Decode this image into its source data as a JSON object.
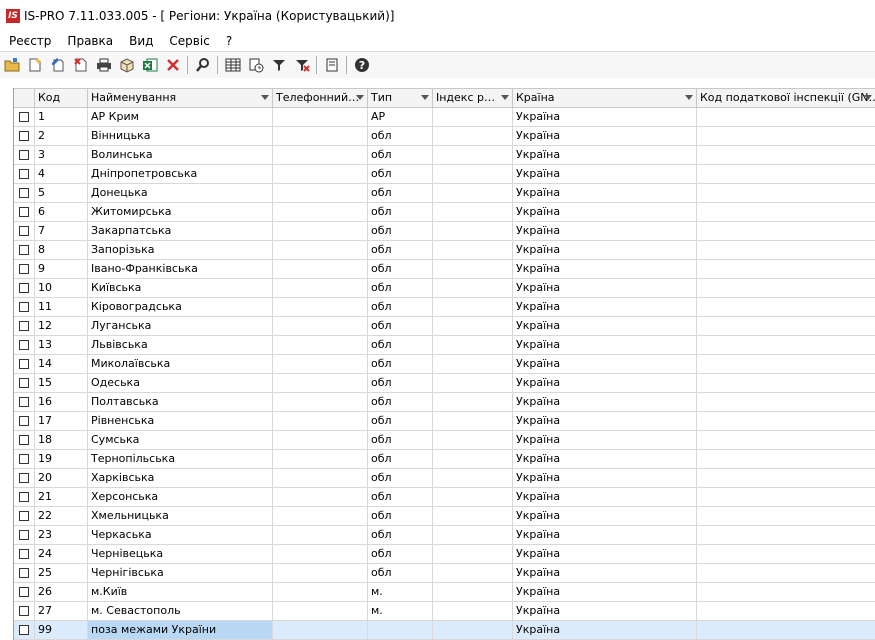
{
  "window": {
    "title": "IS-PRO 7.11.033.005 - [ Регіони: Україна (Користувацький)]",
    "logo_text": "IS"
  },
  "menu": [
    "Реєстр",
    "Правка",
    "Вид",
    "Сервіс",
    "?"
  ],
  "columns": {
    "code": "Код",
    "name": "Найменування",
    "phone": "Телефонний…",
    "type": "Тип",
    "index": "Індекс р…",
    "country": "Країна",
    "tax": "Код податкової інспекції (GN…"
  },
  "rows": [
    {
      "code": "1",
      "name": "АР Крим",
      "type": "АР",
      "country": "Україна"
    },
    {
      "code": "2",
      "name": "Вінницька",
      "type": "обл",
      "country": "Україна"
    },
    {
      "code": "3",
      "name": "Волинська",
      "type": "обл",
      "country": "Україна"
    },
    {
      "code": "4",
      "name": "Дніпропетровська",
      "type": "обл",
      "country": "Україна"
    },
    {
      "code": "5",
      "name": "Донецька",
      "type": "обл",
      "country": "Україна"
    },
    {
      "code": "6",
      "name": "Житомирська",
      "type": "обл",
      "country": "Україна"
    },
    {
      "code": "7",
      "name": "Закарпатська",
      "type": "обл",
      "country": "Україна"
    },
    {
      "code": "8",
      "name": "Запорізька",
      "type": "обл",
      "country": "Україна"
    },
    {
      "code": "9",
      "name": "Івано-Франківська",
      "type": "обл",
      "country": "Україна"
    },
    {
      "code": "10",
      "name": "Київська",
      "type": "обл",
      "country": "Україна"
    },
    {
      "code": "11",
      "name": "Кіровоградська",
      "type": "обл",
      "country": "Україна"
    },
    {
      "code": "12",
      "name": "Луганська",
      "type": "обл",
      "country": "Україна"
    },
    {
      "code": "13",
      "name": "Львівська",
      "type": "обл",
      "country": "Україна"
    },
    {
      "code": "14",
      "name": "Миколаївська",
      "type": "обл",
      "country": "Україна"
    },
    {
      "code": "15",
      "name": "Одеська",
      "type": "обл",
      "country": "Україна"
    },
    {
      "code": "16",
      "name": "Полтавська",
      "type": "обл",
      "country": "Україна"
    },
    {
      "code": "17",
      "name": "Рівненська",
      "type": "обл",
      "country": "Україна"
    },
    {
      "code": "18",
      "name": "Сумська",
      "type": "обл",
      "country": "Україна"
    },
    {
      "code": "19",
      "name": "Тернопільська",
      "type": "обл",
      "country": "Україна"
    },
    {
      "code": "20",
      "name": "Харківська",
      "type": "обл",
      "country": "Україна"
    },
    {
      "code": "21",
      "name": "Херсонська",
      "type": "обл",
      "country": "Україна"
    },
    {
      "code": "22",
      "name": "Хмельницька",
      "type": "обл",
      "country": "Україна"
    },
    {
      "code": "23",
      "name": "Черкаська",
      "type": "обл",
      "country": "Україна"
    },
    {
      "code": "24",
      "name": "Чернівецька",
      "type": "обл",
      "country": "Україна"
    },
    {
      "code": "25",
      "name": "Чернігівська",
      "type": "обл",
      "country": "Україна"
    },
    {
      "code": "26",
      "name": "м.Київ",
      "type": "м.",
      "country": "Україна"
    },
    {
      "code": "27",
      "name": "м. Севастополь",
      "type": "м.",
      "country": "Україна"
    },
    {
      "code": "99",
      "name": "поза межами України",
      "type": "",
      "country": "Україна",
      "selected": true
    }
  ]
}
